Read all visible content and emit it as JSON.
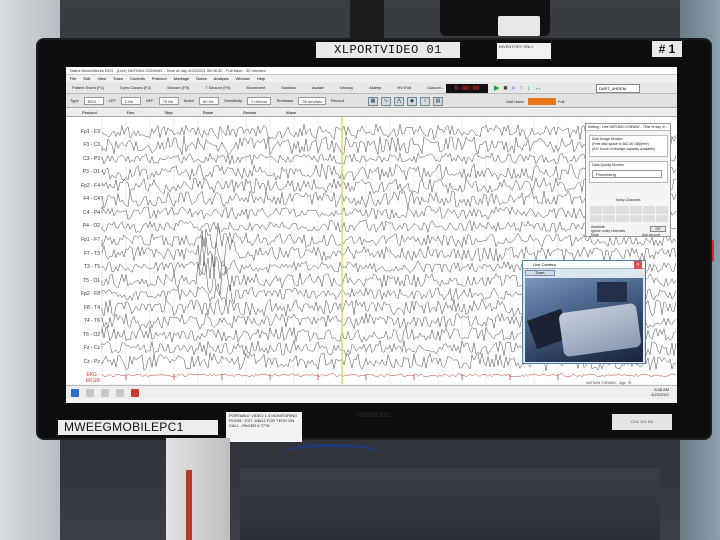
{
  "monitor": {
    "top_label": "XLPORTVIDEO 01",
    "number_tag": "# 1",
    "inventory_tag": "INVENTORY ONLY",
    "bottom_label": "MWEEGMOBILEPC1"
  },
  "app": {
    "title": "Natus NeuroWorks EEG - (Live) NATHAN CONWAY - Time of day 4/22/2021 08:06:32 - Full trace - 30 mm/sec",
    "menu": [
      "File",
      "Edit",
      "View",
      "Trace",
      "Controls",
      "Protocol",
      "Montage",
      "Notes",
      "Analysis",
      "Window",
      "Help"
    ],
    "toolbar1": [
      "Patient Event (F1)",
      "Eyes Closed (F2)",
      "Seizure (F5)",
      "7 Seizure (F5)",
      "Movement",
      "Swallow",
      "Awake",
      "Drowsy",
      "Asleep",
      "HV End",
      "Custom..."
    ],
    "clock": "0:00:00",
    "patient_dropdown": "DART_4HDEM",
    "toolbar2": {
      "type_label": "Type",
      "type_value": "EEG",
      "lff_label": "LFF",
      "lff_value": "1 Hz",
      "hff_label": "HFF",
      "hff_value": "70 Hz",
      "notch_label": "Notch",
      "notch_value": "60 Hz",
      "sensitivity_label": "Sensitivity",
      "sensitivity_value": "7 uV/mm",
      "timebase_label": "Timebase",
      "timebase_value": "30 mm/sec",
      "record_label": "Record",
      "unit_label": "Unit Used",
      "unit_suffix": "Full"
    },
    "annotation_bar": [
      "Protocol",
      "Fine",
      "Step",
      "Paste",
      "Review",
      "Wave"
    ],
    "channels": [
      "Fp1 - F3",
      "F3 - C3",
      "C3 - P3",
      "P3 - O1",
      "Fp2 - F4",
      "F4 - C4",
      "C4 - P4",
      "P4 - O2",
      "Fp1 - F7",
      "F7 - T3",
      "T3 - T5",
      "T5 - O1",
      "Fp2 - F8",
      "F8 - T4",
      "T4 - T6",
      "T6 - O2",
      "Fz - Cz",
      "Cz - Pz",
      "EKG - EKGR"
    ]
  },
  "side_panel": {
    "header": "Setting - Live NATHAN CONWAY - Time of day 4/...",
    "box1_title": "Disk Usage Monitor",
    "box1_text": "(Free disk space is 362.36 GB)(free)",
    "box1_text2": "(921 hours of storage capacity available)",
    "box2_title": "Data Quality Monitor",
    "box2_value": "Processing",
    "grid_title": "Noisy Channels",
    "opt1": "Autohide",
    "opt2": "Ignore noisy channels",
    "opt3": "Mute",
    "ok": "OK",
    "ack": "Ack second"
  },
  "video": {
    "title": "Live Camera",
    "button": "Zoom"
  },
  "taskbar": {
    "time": "8:08 AM",
    "date": "4/22/2021",
    "user": "NATHAN CONWAY - Age: 76"
  },
  "hardware": {
    "brand": "VIEWSONIC",
    "stand_tag": "PORTABLE VIDEO 1 4 MONITORING ROOM - EXT. 63612 FOR TECH ON CALL - PAGER # 7776",
    "right_tag": "CUL 101 D4"
  },
  "colors": {
    "trace": "#4a4a4a",
    "cursor": "#d8e84a",
    "accent_orange": "#e8781c",
    "clock_red": "#ff3b2f"
  }
}
